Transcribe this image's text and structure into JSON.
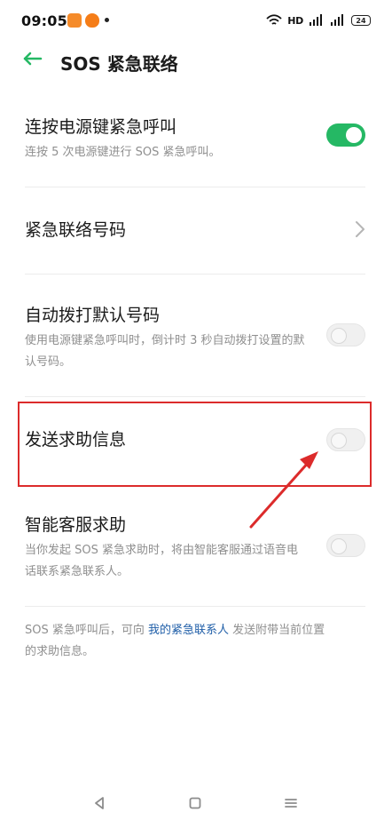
{
  "status_bar": {
    "time": "09:05",
    "network_label": "HD",
    "battery": "24"
  },
  "header": {
    "title": "SOS 紧急联络"
  },
  "settings": [
    {
      "title": "连按电源键紧急呼叫",
      "description": "连按 5 次电源键进行 SOS 紧急呼叫。",
      "toggle": "on"
    },
    {
      "title": "紧急联络号码"
    },
    {
      "title": "自动拨打默认号码",
      "description": "使用电源键紧急呼叫时，倒计时 3 秒自动拨打设置的默认号码。",
      "toggle": "off"
    },
    {
      "title": "发送求助信息",
      "toggle": "off"
    },
    {
      "title": "智能客服求助",
      "description": "当你发起 SOS 紧急求助时，将由智能客服通过语音电话联系紧急联系人。",
      "toggle": "off"
    }
  ],
  "footer": {
    "before": "SOS 紧急呼叫后，可向 ",
    "link": "我的紧急联系人",
    "after": " 发送附带当前位置的求助信息。"
  },
  "colors": {
    "accent_green": "#25b864",
    "annotation_red": "#dc2b2b",
    "link_blue": "#1f5ea8"
  },
  "icons": {
    "back": "arrow-left-icon",
    "chevron": "chevron-right-icon",
    "wifi": "wifi-icon",
    "signal": "signal-icon",
    "nav_back": "nav-back-icon",
    "nav_home": "nav-home-icon",
    "nav_menu": "nav-menu-icon"
  }
}
